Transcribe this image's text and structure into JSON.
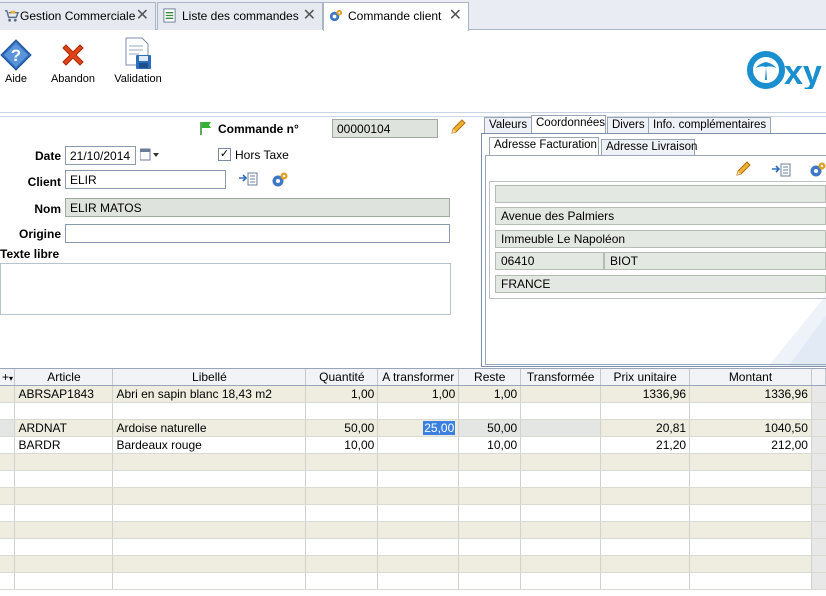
{
  "tabs": [
    {
      "label": "Gestion Commerciale"
    },
    {
      "label": "Liste des commandes"
    },
    {
      "label": "Commande client"
    }
  ],
  "toolbar": {
    "aide": "Aide",
    "abandon": "Abandon",
    "validation": "Validation"
  },
  "brand": {
    "logo_text": "xy",
    "color": "#1a8fd0"
  },
  "form": {
    "commande_label": "Commande n°",
    "commande_value": "00000104",
    "date_label": "Date",
    "date_value": "21/10/2014",
    "hors_taxe_label": "Hors Taxe",
    "hors_taxe_checked": true,
    "client_label": "Client",
    "client_value": "ELIR",
    "nom_label": "Nom",
    "nom_value": "ELIR MATOS",
    "origine_label": "Origine",
    "origine_value": "",
    "texte_libre_label": "Texte libre",
    "texte_libre_value": ""
  },
  "right_tabs": [
    "Valeurs",
    "Coordonnées",
    "Divers",
    "Info. complémentaires"
  ],
  "address_tabs": [
    "Adresse Facturation",
    "Adresse Livraison"
  ],
  "address": {
    "line0": "",
    "line1": "Avenue des Palmiers",
    "line2": "Immeuble Le Napoléon",
    "postcode": "06410",
    "city": "BIOT",
    "country": "FRANCE"
  },
  "grid": {
    "headers": [
      "Article",
      "Libellé",
      "Quantité",
      "A transformer",
      "Reste",
      "Transformée",
      "Prix unitaire",
      "Montant"
    ],
    "rows": [
      {
        "article": "ABRSAP1843",
        "libelle": "Abri en sapin blanc 18,43 m2",
        "quantite": "1,00",
        "atransformer": "1,00",
        "reste": "1,00",
        "transformee": "",
        "prix": "1336,96",
        "montant": "1336,96"
      },
      {
        "article": "",
        "libelle": "",
        "quantite": "",
        "atransformer": "",
        "reste": "",
        "transformee": "",
        "prix": "",
        "montant": ""
      },
      {
        "article": "ARDNAT",
        "libelle": "Ardoise naturelle",
        "quantite": "50,00",
        "atransformer": "25,00",
        "reste": "50,00",
        "transformee": "",
        "prix": "20,81",
        "montant": "1040,50"
      },
      {
        "article": "BARDR",
        "libelle": "Bardeaux rouge",
        "quantite": "10,00",
        "atransformer": "",
        "reste": "10,00",
        "transformee": "",
        "prix": "21,20",
        "montant": "212,00"
      }
    ],
    "empty_rows": 8
  }
}
